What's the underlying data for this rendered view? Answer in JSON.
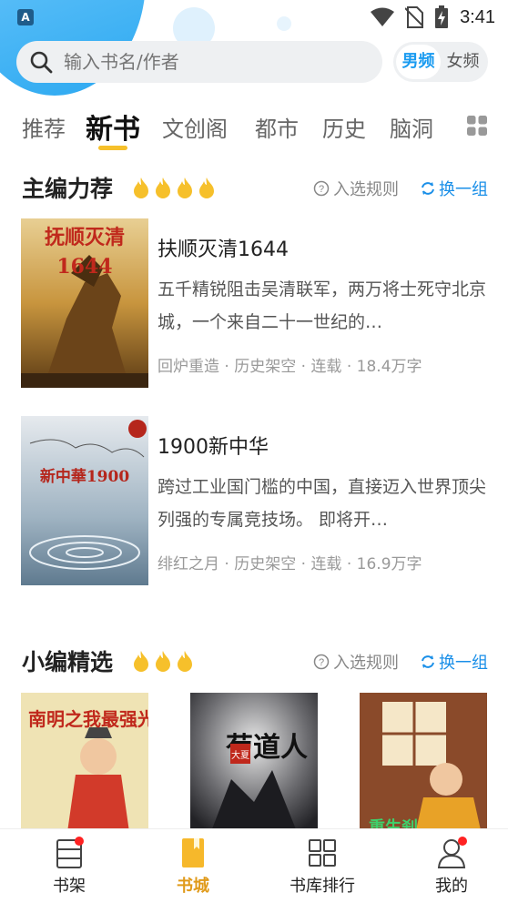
{
  "status_bar": {
    "app_icon_letter": "A",
    "time": "3:41"
  },
  "search": {
    "placeholder": "输入书名/作者"
  },
  "gender": {
    "male": "男频",
    "female": "女频"
  },
  "tabs": [
    {
      "label": "推荐"
    },
    {
      "label": "新书"
    },
    {
      "label": "文创阁"
    },
    {
      "label": "都市"
    },
    {
      "label": "历史"
    },
    {
      "label": "脑洞"
    }
  ],
  "section1": {
    "title": "主编力荐",
    "rule_label": "入选规则",
    "refresh_label": "换一组",
    "books": [
      {
        "title": "扶顺灭清1644",
        "cover_text": "抚顺灭清",
        "cover_year": "1644",
        "desc": "五千精锐阻击吴清联军，两万将士死守北京城，一个来自二十一世纪的…",
        "author": "回炉重造",
        "category": "历史架空",
        "status": "连载",
        "words": "18.4万字"
      },
      {
        "title": "1900新中华",
        "cover_text": "新中華1900",
        "desc": "跨过工业国门槛的中国，直接迈入世界顶尖列强的专属竞技场。 即将开…",
        "author": "绯红之月",
        "category": "历史架空",
        "status": "连载",
        "words": "16.9万字"
      }
    ]
  },
  "section2": {
    "title": "小编精选",
    "rule_label": "入选规则",
    "refresh_label": "换一组",
    "covers": [
      {
        "cover_text": "南明之我最强光"
      },
      {
        "cover_text": "苟道人",
        "cover_badge": "大夏"
      },
      {
        "cover_text": "重生刹"
      }
    ]
  },
  "bottom_nav": [
    {
      "label": "书架",
      "icon": "bookshelf-icon"
    },
    {
      "label": "书城",
      "icon": "bookstore-icon"
    },
    {
      "label": "书库排行",
      "icon": "ranking-grid-icon"
    },
    {
      "label": "我的",
      "icon": "profile-icon"
    }
  ],
  "colors": {
    "accent": "#1a9bf0",
    "active_nav": "#e09a1a",
    "flame": "#f6c02b"
  }
}
